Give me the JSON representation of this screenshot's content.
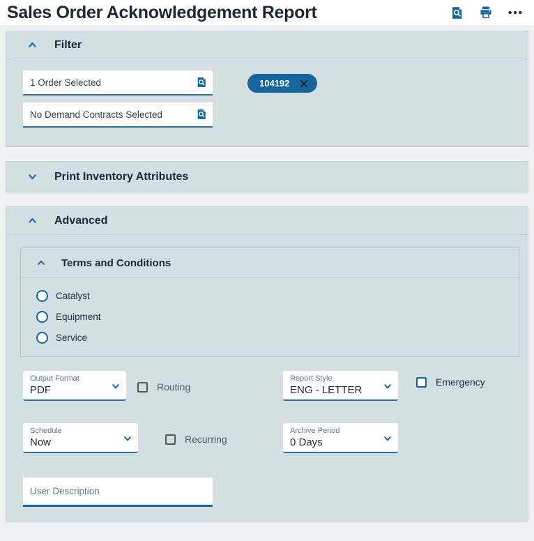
{
  "header": {
    "title": "Sales Order Acknowledgement Report",
    "icons": [
      "preview-report-icon",
      "print-icon",
      "more-actions-icon"
    ]
  },
  "filter": {
    "label": "Filter",
    "orders_field": {
      "value": "1 Order Selected"
    },
    "order_chip": {
      "label": "104192"
    },
    "contracts_field": {
      "value": "No Demand Contracts Selected"
    }
  },
  "print_inventory": {
    "label": "Print Inventory Attributes"
  },
  "advanced": {
    "label": "Advanced",
    "terms": {
      "label": "Terms and Conditions",
      "options": [
        "Catalyst",
        "Equipment",
        "Service"
      ],
      "selected": null
    },
    "output_format": {
      "label": "Output Format",
      "value": "PDF"
    },
    "routing": {
      "label": "Routing",
      "checked": false
    },
    "report_style": {
      "label": "Report Style",
      "value": "ENG - LETTER"
    },
    "emergency": {
      "label": "Emergency",
      "checked": false
    },
    "schedule": {
      "label": "Schedule",
      "value": "Now"
    },
    "recurring": {
      "label": "Recurring",
      "checked": false
    },
    "archive_period": {
      "label": "Archive Period",
      "value": "0 Days"
    },
    "user_description": {
      "placeholder": "User Description",
      "value": ""
    }
  },
  "colors": {
    "page_bg": "#eef1f2",
    "card_bg": "#d3dfe3",
    "accent_blue": "#15669c",
    "underline_blue": "#2e6f9e",
    "focused_underline": "#0e63a5",
    "chip_bg": "#15669c",
    "title_text": "#1c2833"
  }
}
